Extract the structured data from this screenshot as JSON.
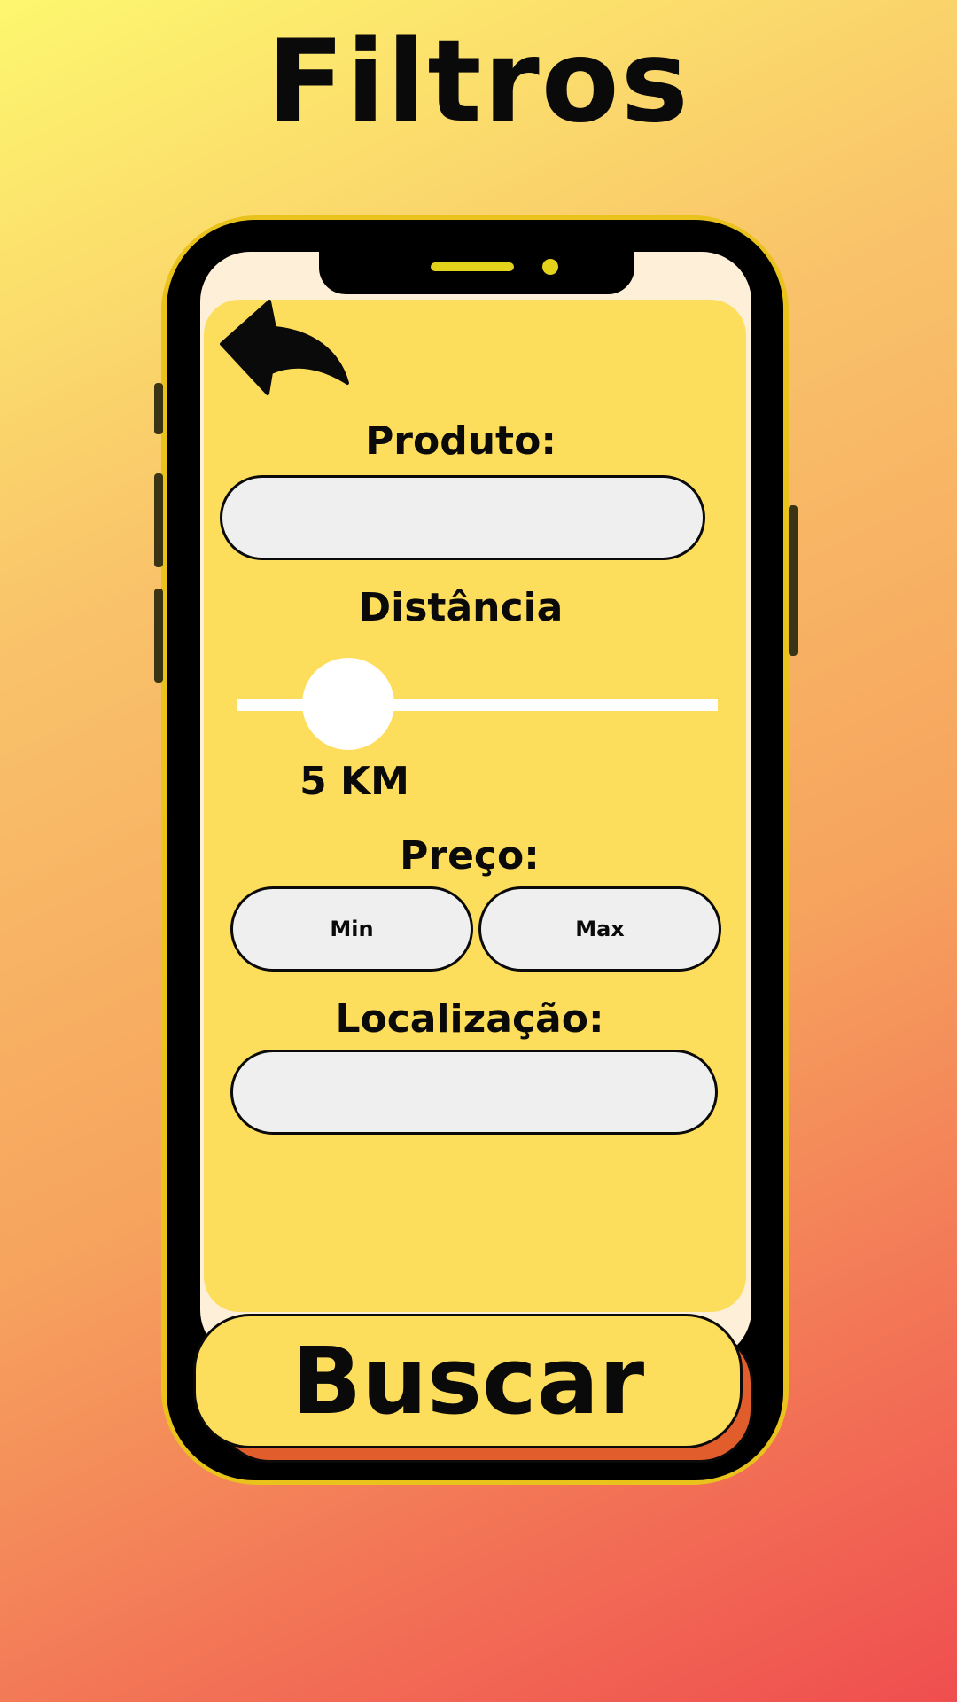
{
  "header": {
    "title": "Filtros"
  },
  "filters": {
    "product_label": "Produto:",
    "product_value": "",
    "distance_label": "Distância",
    "distance_value": "5 KM",
    "distance_fraction": 0.23,
    "price_label": "Preço:",
    "price_min_label": "Min",
    "price_max_label": "Max",
    "location_label": "Localização:",
    "location_value": ""
  },
  "actions": {
    "search_label": "Buscar"
  },
  "icons": {
    "back": "back-arrow-icon"
  },
  "colors": {
    "panel": "#fddd5c",
    "phone_frame": "#000000",
    "phone_rim": "#e9c21c",
    "field": "#efefef",
    "button_shadow": "#e25d2c"
  }
}
